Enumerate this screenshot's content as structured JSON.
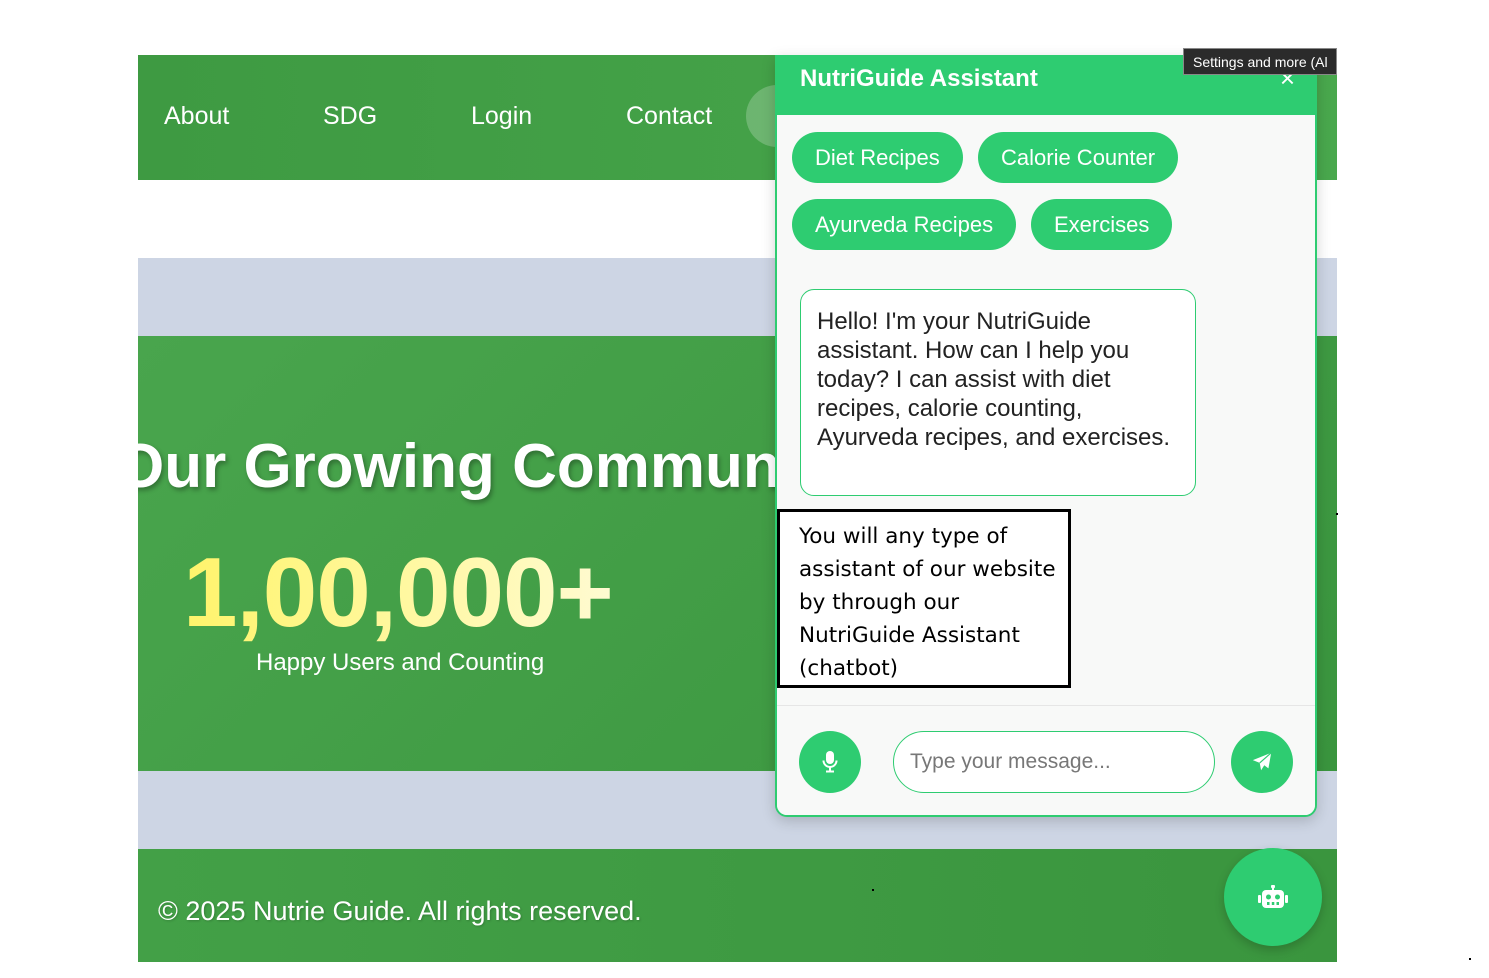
{
  "navbar": {
    "links": [
      "About",
      "SDG",
      "Login",
      "Contact"
    ]
  },
  "community": {
    "title": "Our Growing Community",
    "count": "1,00,000+",
    "subtitle": "Happy Users and Counting"
  },
  "footer": {
    "text": "© 2025 Nutrie Guide. All rights reserved."
  },
  "chat": {
    "title": "NutriGuide Assistant",
    "close_label": "×",
    "chips": [
      "Diet Recipes",
      "Calorie Counter",
      "Ayurveda Recipes",
      "Exercises"
    ],
    "bot_message": "Hello! I'm your NutriGuide assistant. How can I help you today? I can assist with diet recipes, calorie counting, Ayurveda recipes, and exercises.",
    "input_placeholder": "Type your message...",
    "mic_icon": "microphone-icon",
    "send_icon": "paper-plane-icon"
  },
  "tooltip": {
    "text": "Settings and more (Al"
  },
  "annotation": {
    "text": "You will any type of assistant of our website by through our NutriGuide Assistant (chatbot)"
  },
  "fab": {
    "icon": "robot-icon"
  },
  "colors": {
    "nav_green": "#43a047",
    "chat_green": "#2ecc71",
    "count_yellow": "#fff46b",
    "page_bg": "#cdd5e4"
  }
}
